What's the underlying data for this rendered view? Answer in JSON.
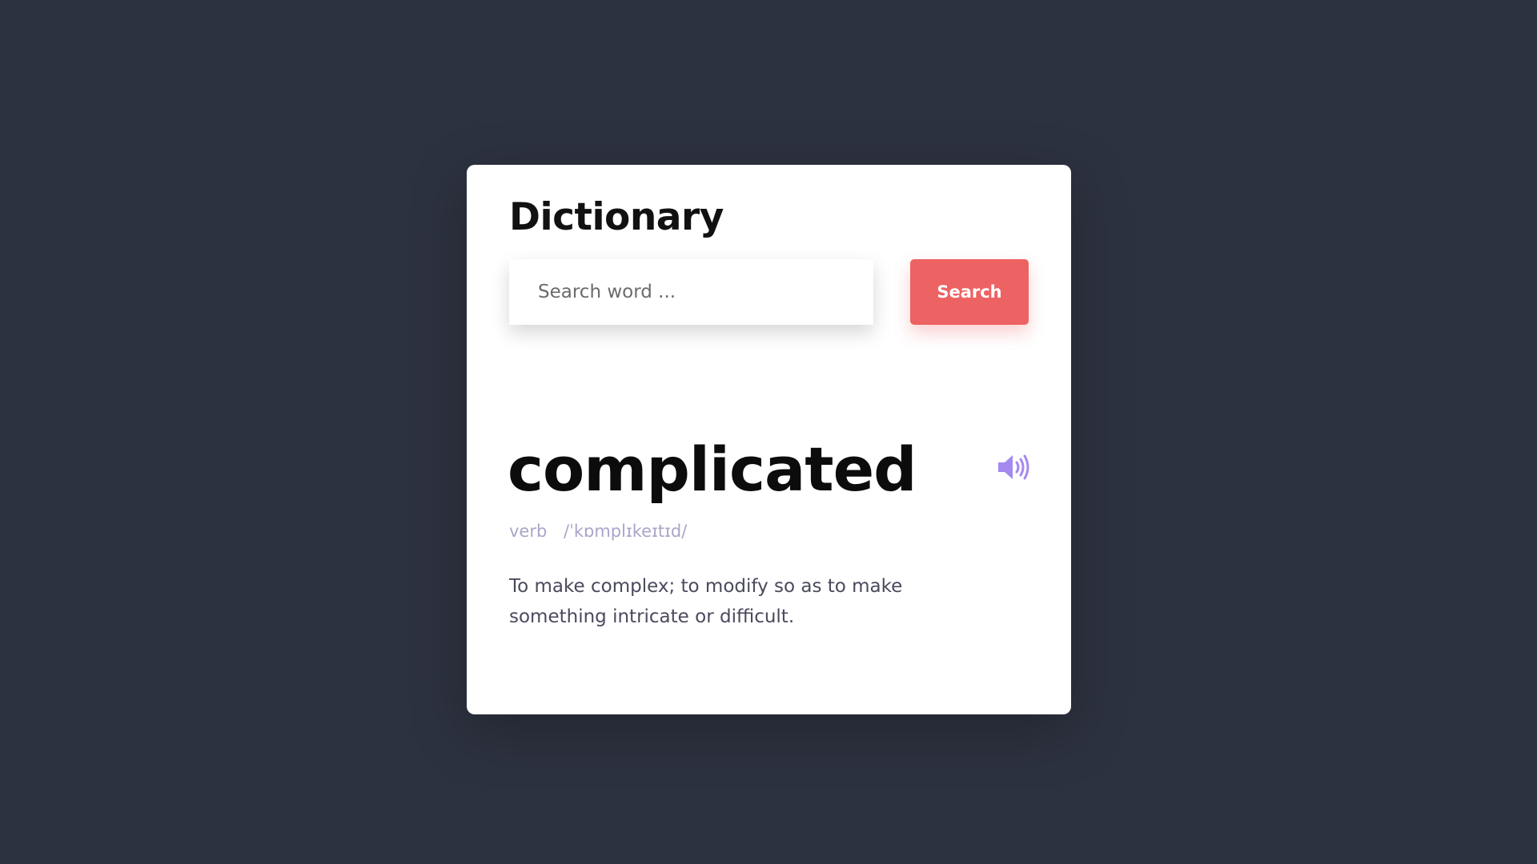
{
  "app": {
    "title": "Dictionary"
  },
  "search": {
    "placeholder": "Search word ...",
    "value": "",
    "button_label": "Search"
  },
  "result": {
    "word": "complicated",
    "part_of_speech": "verb",
    "phonetic": "/ˈkɒmplɪkeɪtɪd/",
    "definition": "To make complex; to modify so as to make something intricate or difficult.",
    "audio_icon": "speaker-icon"
  },
  "colors": {
    "background": "#2d3240",
    "card": "#ffffff",
    "accent": "#ed6262",
    "icon": "#a48af0",
    "muted_text": "#a9a6c9",
    "body_text": "#4a4a5e"
  }
}
